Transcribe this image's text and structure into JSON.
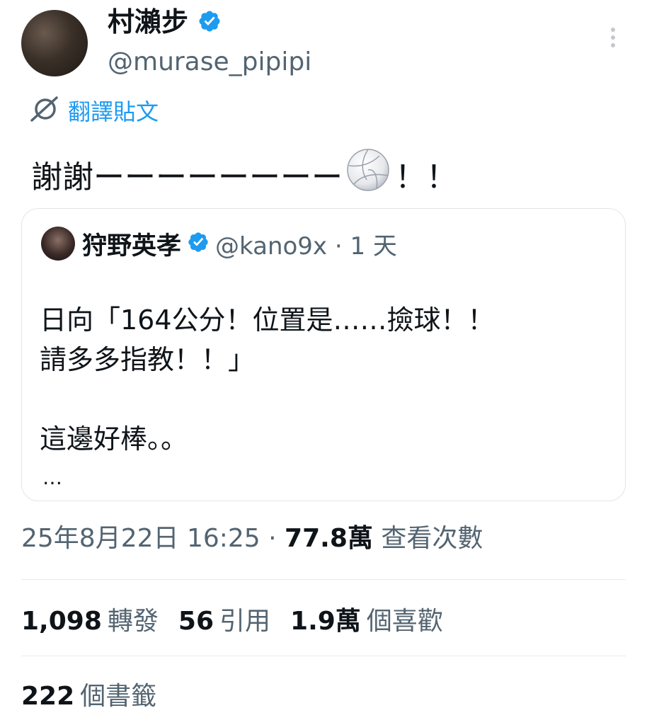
{
  "author": {
    "display_name": "村瀨步",
    "handle": "@murase_pipipi",
    "verified_icon": "verified-badge-icon"
  },
  "translate": {
    "icon": "translate-icon",
    "label": "翻譯貼文"
  },
  "tweet": {
    "text_before": "謝謝ーーーーーーーー",
    "emoji": "volleyball-icon",
    "text_after": "！！"
  },
  "quote": {
    "display_name": "狩野英孝",
    "handle_time": "@kano9x · 1 天",
    "lines": [
      "日向「164公分！位置是……撿球！！",
      "請多多指教！！」",
      "",
      "這邊好棒。。"
    ],
    "truncation": "…"
  },
  "meta": {
    "timestamp": "25年8月22日 16:25 · ",
    "views_count": "77.8萬",
    "views_label": " 查看次數"
  },
  "stats": [
    {
      "count": "1,098",
      "label": "轉發"
    },
    {
      "count": "56",
      "label": "引用"
    },
    {
      "count": "1.9萬",
      "label": "個喜歡"
    }
  ],
  "bookmarks": {
    "count": "222",
    "label": "個書籤"
  },
  "colors": {
    "accent": "#1d9bf0",
    "secondary_text": "#536471",
    "text": "#0f1419",
    "border": "#e1e6ea"
  }
}
